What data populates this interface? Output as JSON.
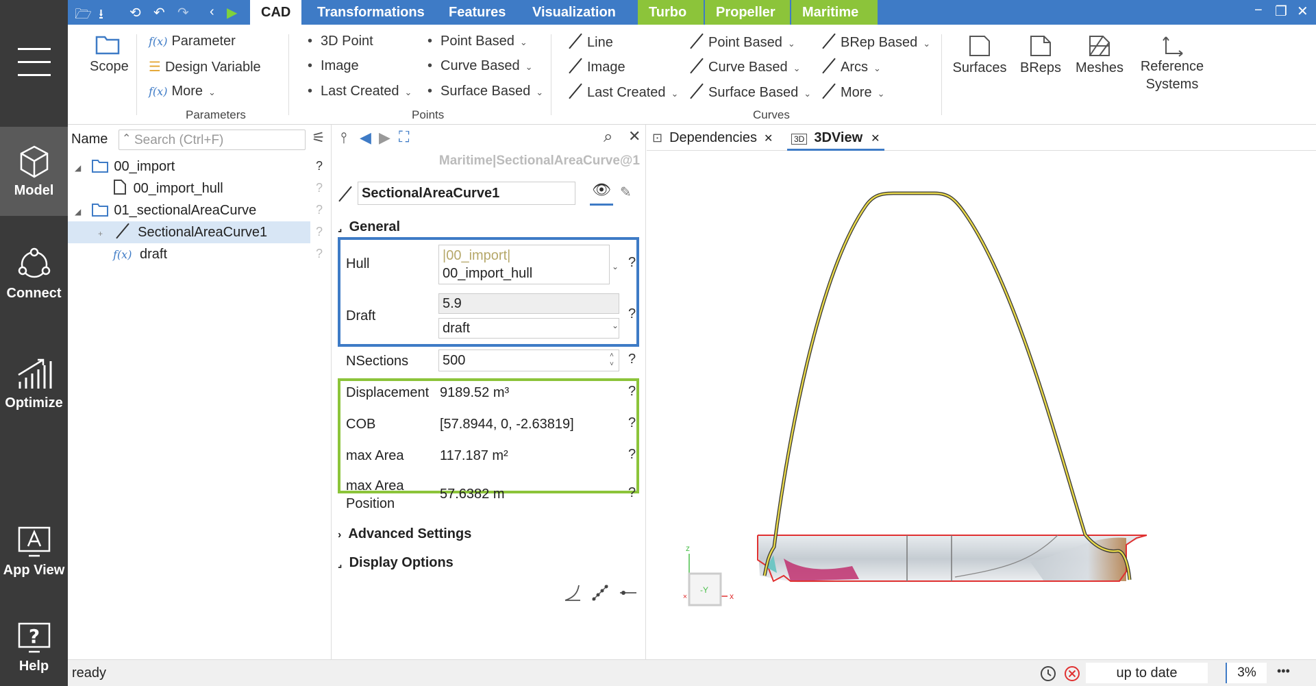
{
  "title_bar": {
    "tabs": [
      "CAD",
      "Transformations",
      "Features",
      "Visualization",
      "Turbo",
      "Propeller",
      "Maritime"
    ],
    "active_tab": "CAD",
    "minimize": "−",
    "restore": "❐",
    "close": "✕"
  },
  "sidebar": {
    "items": [
      {
        "label": "Model",
        "icon": "cube-icon",
        "active": true
      },
      {
        "label": "Connect",
        "icon": "network-icon"
      },
      {
        "label": "Optimize",
        "icon": "chart-up-icon"
      },
      {
        "label": "App View",
        "icon": "app-view-icon"
      },
      {
        "label": "Help",
        "icon": "help-icon"
      }
    ]
  },
  "ribbon": {
    "scope": "Scope",
    "parameters": {
      "items": [
        "Parameter",
        "Design Variable",
        "More"
      ],
      "label": "Parameters"
    },
    "points": {
      "col1": [
        "3D Point",
        "Image",
        "Last Created"
      ],
      "col2": [
        "Point Based",
        "Curve Based",
        "Surface Based"
      ],
      "label": "Points"
    },
    "curves": {
      "col1": [
        "Line",
        "Image",
        "Last Created"
      ],
      "col2": [
        "Point Based",
        "Curve Based",
        "Surface Based"
      ],
      "col3": [
        "BRep Based",
        "Arcs",
        "More"
      ],
      "label": "Curves"
    },
    "big": [
      "Surfaces",
      "BReps",
      "Meshes",
      "Reference",
      "Systems"
    ]
  },
  "tree": {
    "header": "Name",
    "search_placeholder": "Search (Ctrl+F)",
    "rows": [
      {
        "label": "00_import",
        "level": 0,
        "type": "folder"
      },
      {
        "label": "00_import_hull",
        "level": 1,
        "type": "file"
      },
      {
        "label": "01_sectionalAreaCurve",
        "level": 0,
        "type": "folder"
      },
      {
        "label": "SectionalAreaCurve1",
        "level": 1,
        "type": "curve",
        "selected": true
      },
      {
        "label": "draft",
        "level": 1,
        "type": "fx"
      }
    ],
    "help": "?"
  },
  "props": {
    "path": "Maritime|SectionalAreaCurve@1",
    "name": "SectionalAreaCurve1",
    "general": "General",
    "hull_label": "Hull",
    "hull_ref": "|00_import|",
    "hull_value": "00_import_hull",
    "draft_label": "Draft",
    "draft_value": "5.9",
    "draft_ref": "draft",
    "nsections_label": "NSections",
    "nsections_value": "500",
    "displacement_label": "Displacement",
    "displacement_value": "9189.52 m³",
    "cob_label": "COB",
    "cob_value": "[57.8944, 0, -2.63819]",
    "maxarea_label": "max Area",
    "maxarea_value": "117.187 m²",
    "maxareapos_label1": "max Area",
    "maxareapos_label2": "Position",
    "maxareapos_value": "57.6382 m",
    "advanced": "Advanced Settings",
    "display": "Display Options",
    "help": "?"
  },
  "view": {
    "tabs": [
      "Dependencies",
      "3DView"
    ],
    "active": "3DView",
    "axis_z": "z",
    "axis_x": "x",
    "axis_label": "-Y"
  },
  "status": {
    "text": "ready",
    "state": "up to date",
    "zoom": "3%",
    "more": "•••"
  },
  "colors": {
    "accent": "#3e7bc6",
    "green": "#8cc43a",
    "sidebar": "#3a3a3a",
    "red": "#e03030"
  }
}
